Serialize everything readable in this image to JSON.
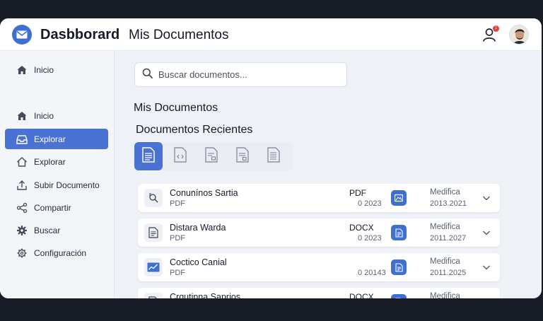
{
  "header": {
    "app_title": "Dasbborard",
    "page_title": "Mis Documentos",
    "notification_count": "1"
  },
  "sidebar": {
    "items": [
      {
        "label": "Inicio",
        "icon": "home-icon",
        "active": false
      },
      {
        "label": "Inicio",
        "icon": "home-icon",
        "active": false
      },
      {
        "label": "Explorar",
        "icon": "inbox-icon",
        "active": true
      },
      {
        "label": "Explorar",
        "icon": "home-outline-icon",
        "active": false
      },
      {
        "label": "Subir Documento",
        "icon": "upload-icon",
        "active": false
      },
      {
        "label": "Compartir",
        "icon": "share-icon",
        "active": false
      },
      {
        "label": "Buscar",
        "icon": "gear-icon",
        "active": false
      },
      {
        "label": "Configuración",
        "icon": "gear-icon",
        "active": false
      }
    ]
  },
  "search": {
    "placeholder": "Buscar documentos..."
  },
  "main": {
    "title": "Mis Documentos",
    "section_title": "Documentos Recientes"
  },
  "documents": [
    {
      "name": "Conunínos Sartia",
      "sub": "PDF",
      "type": "PDF",
      "code": "0 2023",
      "modified_label": "Medifica",
      "date": "2013.2021",
      "icon": "search-doc-icon"
    },
    {
      "name": "Distara Warda",
      "sub": "PDF",
      "type": "DOCX",
      "code": "0 2023",
      "modified_label": "Medifica",
      "date": "2011.2027",
      "icon": "doc-lines-icon"
    },
    {
      "name": "Coctico Canial",
      "sub": "PDF",
      "type": "",
      "code": "0 20143",
      "modified_label": "Medifica",
      "date": "2011.2025",
      "icon": "chart-icon"
    },
    {
      "name": "Crqutinna Saprios",
      "sub": "",
      "type": "DOCX",
      "code": "",
      "modified_label": "Medifica",
      "date": "",
      "icon": "doc-lines-icon"
    }
  ],
  "colors": {
    "accent": "#4a72d4",
    "badge": "#e0433d",
    "background": "#eef1f6",
    "outer": "#171c27"
  }
}
